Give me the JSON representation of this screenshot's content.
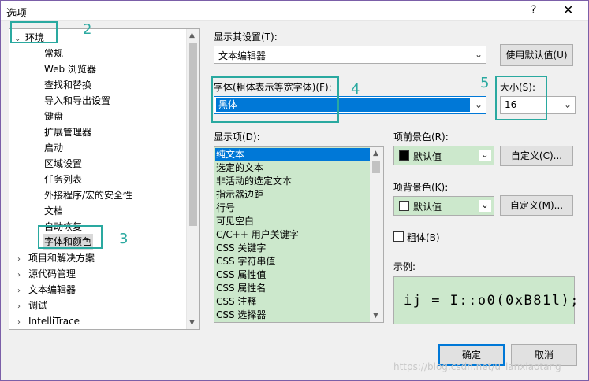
{
  "window": {
    "title": "选项",
    "help": "?",
    "close": "✕"
  },
  "tree": {
    "items": [
      {
        "label": "环境",
        "expander": "⌄"
      },
      {
        "label": "常规"
      },
      {
        "label": "Web 浏览器"
      },
      {
        "label": "查找和替换"
      },
      {
        "label": "导入和导出设置"
      },
      {
        "label": "键盘"
      },
      {
        "label": "扩展管理器"
      },
      {
        "label": "启动"
      },
      {
        "label": "区域设置"
      },
      {
        "label": "任务列表"
      },
      {
        "label": "外接程序/宏的安全性"
      },
      {
        "label": "文档"
      },
      {
        "label": "自动恢复"
      },
      {
        "label": "字体和颜色"
      },
      {
        "label": "项目和解决方案",
        "expander": "›"
      },
      {
        "label": "源代码管理",
        "expander": "›"
      },
      {
        "label": "文本编辑器",
        "expander": "›"
      },
      {
        "label": "调试",
        "expander": "›"
      },
      {
        "label": "IntelliTrace",
        "expander": "›"
      }
    ]
  },
  "settings": {
    "show_label": "显示其设置(T):",
    "show_value": "文本编辑器",
    "use_defaults": "使用默认值(U)",
    "font_label": "字体(粗体表示等宽字体)(F):",
    "font_value": "黑体",
    "size_label": "大小(S):",
    "size_value": "16",
    "display_items_label": "显示项(D):",
    "display_items": [
      "纯文本",
      "选定的文本",
      "非活动的选定文本",
      "指示器边距",
      "行号",
      "可见空白",
      "C/C++ 用户关键字",
      "CSS 关键字",
      "CSS 字符串值",
      "CSS 属性值",
      "CSS 属性名",
      "CSS 注释",
      "CSS 选择器"
    ],
    "fg_label": "项前景色(R):",
    "fg_value": "默认值",
    "fg_custom": "自定义(C)...",
    "bg_label": "项背景色(K):",
    "bg_value": "默认值",
    "bg_custom": "自定义(M)...",
    "bold_label": "粗体(B)",
    "sample_label": "示例:",
    "sample_text": "ij = I::o0(0xB81l);"
  },
  "buttons": {
    "ok": "确定",
    "cancel": "取消"
  },
  "annotations": [
    "2",
    "3",
    "4",
    "5"
  ],
  "watermark": "https://blog.csdn.net/u_lanxiaotang",
  "colors": {
    "accent": "#0078d7",
    "annotation": "#2aa9a0",
    "list_bg": "#cce8cc"
  },
  "icons": {
    "dropdown": "⌄",
    "scroll_up": "▲",
    "scroll_down": "▼"
  }
}
